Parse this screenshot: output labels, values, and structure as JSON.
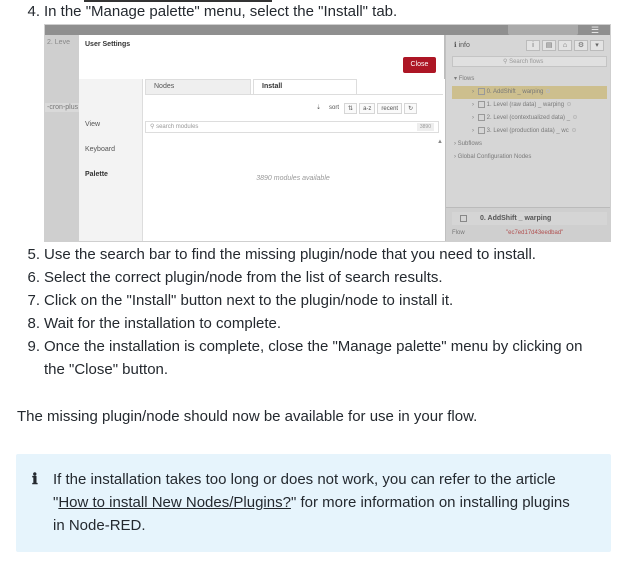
{
  "steps": {
    "step4": {
      "num": "4.",
      "text": "In the \"Manage palette\" menu, select the \"Install\" tab."
    },
    "step5": {
      "num": "5.",
      "text": "Use the search bar to find the missing plugin/node that you need to install."
    },
    "step6": {
      "num": "6.",
      "text": "Select the correct plugin/node from the list of search results."
    },
    "step7": {
      "num": "7.",
      "text": "Click on the \"Install\" button next to the plugin/node to install it."
    },
    "step8": {
      "num": "8.",
      "text": "Wait for the installation to complete."
    },
    "step9": {
      "num": "9.",
      "text": "Once the installation is complete, close the \"Manage palette\" menu by clicking on",
      "text2": "the \"Close\" button."
    }
  },
  "screenshot": {
    "top_tab_ghost": "2. Leve",
    "cron_ghost": "-cron-plus",
    "dialog": {
      "title": "User Settings",
      "close_label": "Close",
      "sidebar": [
        "View",
        "Keyboard",
        "Palette"
      ],
      "tabs": {
        "nodes": "Nodes",
        "install": "Install"
      },
      "toolbar": {
        "sort_icon": "sort-icon",
        "sort": "sort",
        "az": "a-z",
        "recent": "recent",
        "refresh": "↻"
      },
      "search_placeholder": "search modules",
      "search_count": "3890",
      "available": "3890 modules available"
    },
    "info_panel": {
      "title": "info",
      "search_placeholder": "Search flows",
      "tree": [
        {
          "label": "Flows",
          "level": 0,
          "selected": false
        },
        {
          "label": "0. AddShift _ warping",
          "level": 2,
          "selected": true
        },
        {
          "label": "1. Level (raw data) _ warping",
          "level": 2,
          "selected": false
        },
        {
          "label": "2. Level (contextualized data) _",
          "level": 2,
          "selected": false
        },
        {
          "label": "3. Level (production data) _ wc",
          "level": 2,
          "selected": false
        },
        {
          "label": "Subflows",
          "level": 0,
          "selected": false
        },
        {
          "label": "Global Configuration Nodes",
          "level": 0,
          "selected": false
        }
      ],
      "selected_node": "0. AddShift _ warping",
      "flow_label": "Flow",
      "flow_id": "\"ec7ed17d43eedbad\""
    }
  },
  "paragraph": "The missing plugin/node should now be available for use in your flow.",
  "callout": {
    "icon": "info-icon",
    "line1": "If the installation takes too long or does not work, you can refer to the article",
    "line2_pre": "\"",
    "link": "How to install New Nodes/Plugins?",
    "line2_post": "\" for more information on installing plugins",
    "line3": "in Node-RED.",
    "bg": "#e6f4fc"
  }
}
